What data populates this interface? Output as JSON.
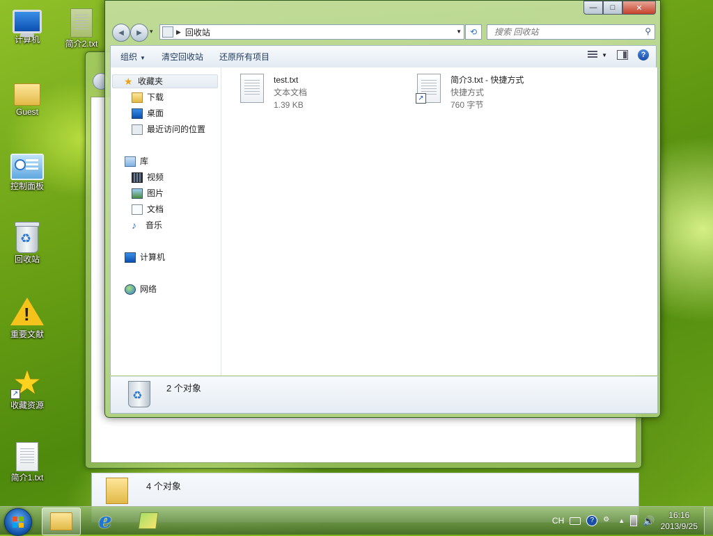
{
  "desktop": {
    "icons": [
      {
        "label": "计算机",
        "icon": "computer-icon"
      },
      {
        "label": "简介2.txt",
        "icon": "text-file-icon"
      },
      {
        "label": "Guest",
        "icon": "user-folder-icon"
      },
      {
        "label": "控制面板",
        "icon": "control-panel-icon"
      },
      {
        "label": "回收站",
        "icon": "recycle-bin-icon"
      },
      {
        "label": "重要文献",
        "icon": "warning-icon"
      },
      {
        "label": "收藏资源",
        "icon": "star-shortcut-icon"
      },
      {
        "label": "简介1.txt",
        "icon": "text-file-icon"
      }
    ]
  },
  "back_window": {
    "status_text": "4 个对象"
  },
  "window": {
    "caption": {
      "minimize": "—",
      "maximize": "□",
      "close": "✕"
    },
    "nav": {
      "back": "◀",
      "forward": "▶",
      "recent": "▾"
    },
    "address": {
      "separator": "▶",
      "path": "回收站",
      "dropdown": "▼"
    },
    "refresh": "⟲",
    "search": {
      "placeholder": "搜索 回收站",
      "icon": "⚲"
    },
    "toolbar": {
      "organize": "组织",
      "organize_arrow": "▼",
      "empty_bin": "清空回收站",
      "restore_all": "还原所有项目",
      "view_arrow": "▼",
      "help": "?"
    },
    "nav_pane": {
      "favorites": {
        "label": "收藏夹",
        "items": [
          "下载",
          "桌面",
          "最近访问的位置"
        ]
      },
      "libraries": {
        "label": "库",
        "items": [
          "视频",
          "图片",
          "文档",
          "音乐"
        ]
      },
      "computer": "计算机",
      "network": "网络"
    },
    "files": [
      {
        "name": "test.txt",
        "type": "文本文档",
        "size": "1.39 KB",
        "shortcut": false
      },
      {
        "name": "简介3.txt - 快捷方式",
        "type": "快捷方式",
        "size": "760 字节",
        "shortcut": true
      }
    ],
    "status_text": "2 个对象"
  },
  "taskbar": {
    "tray": {
      "language": "CH",
      "time": "16:16",
      "date": "2013/9/25"
    }
  }
}
